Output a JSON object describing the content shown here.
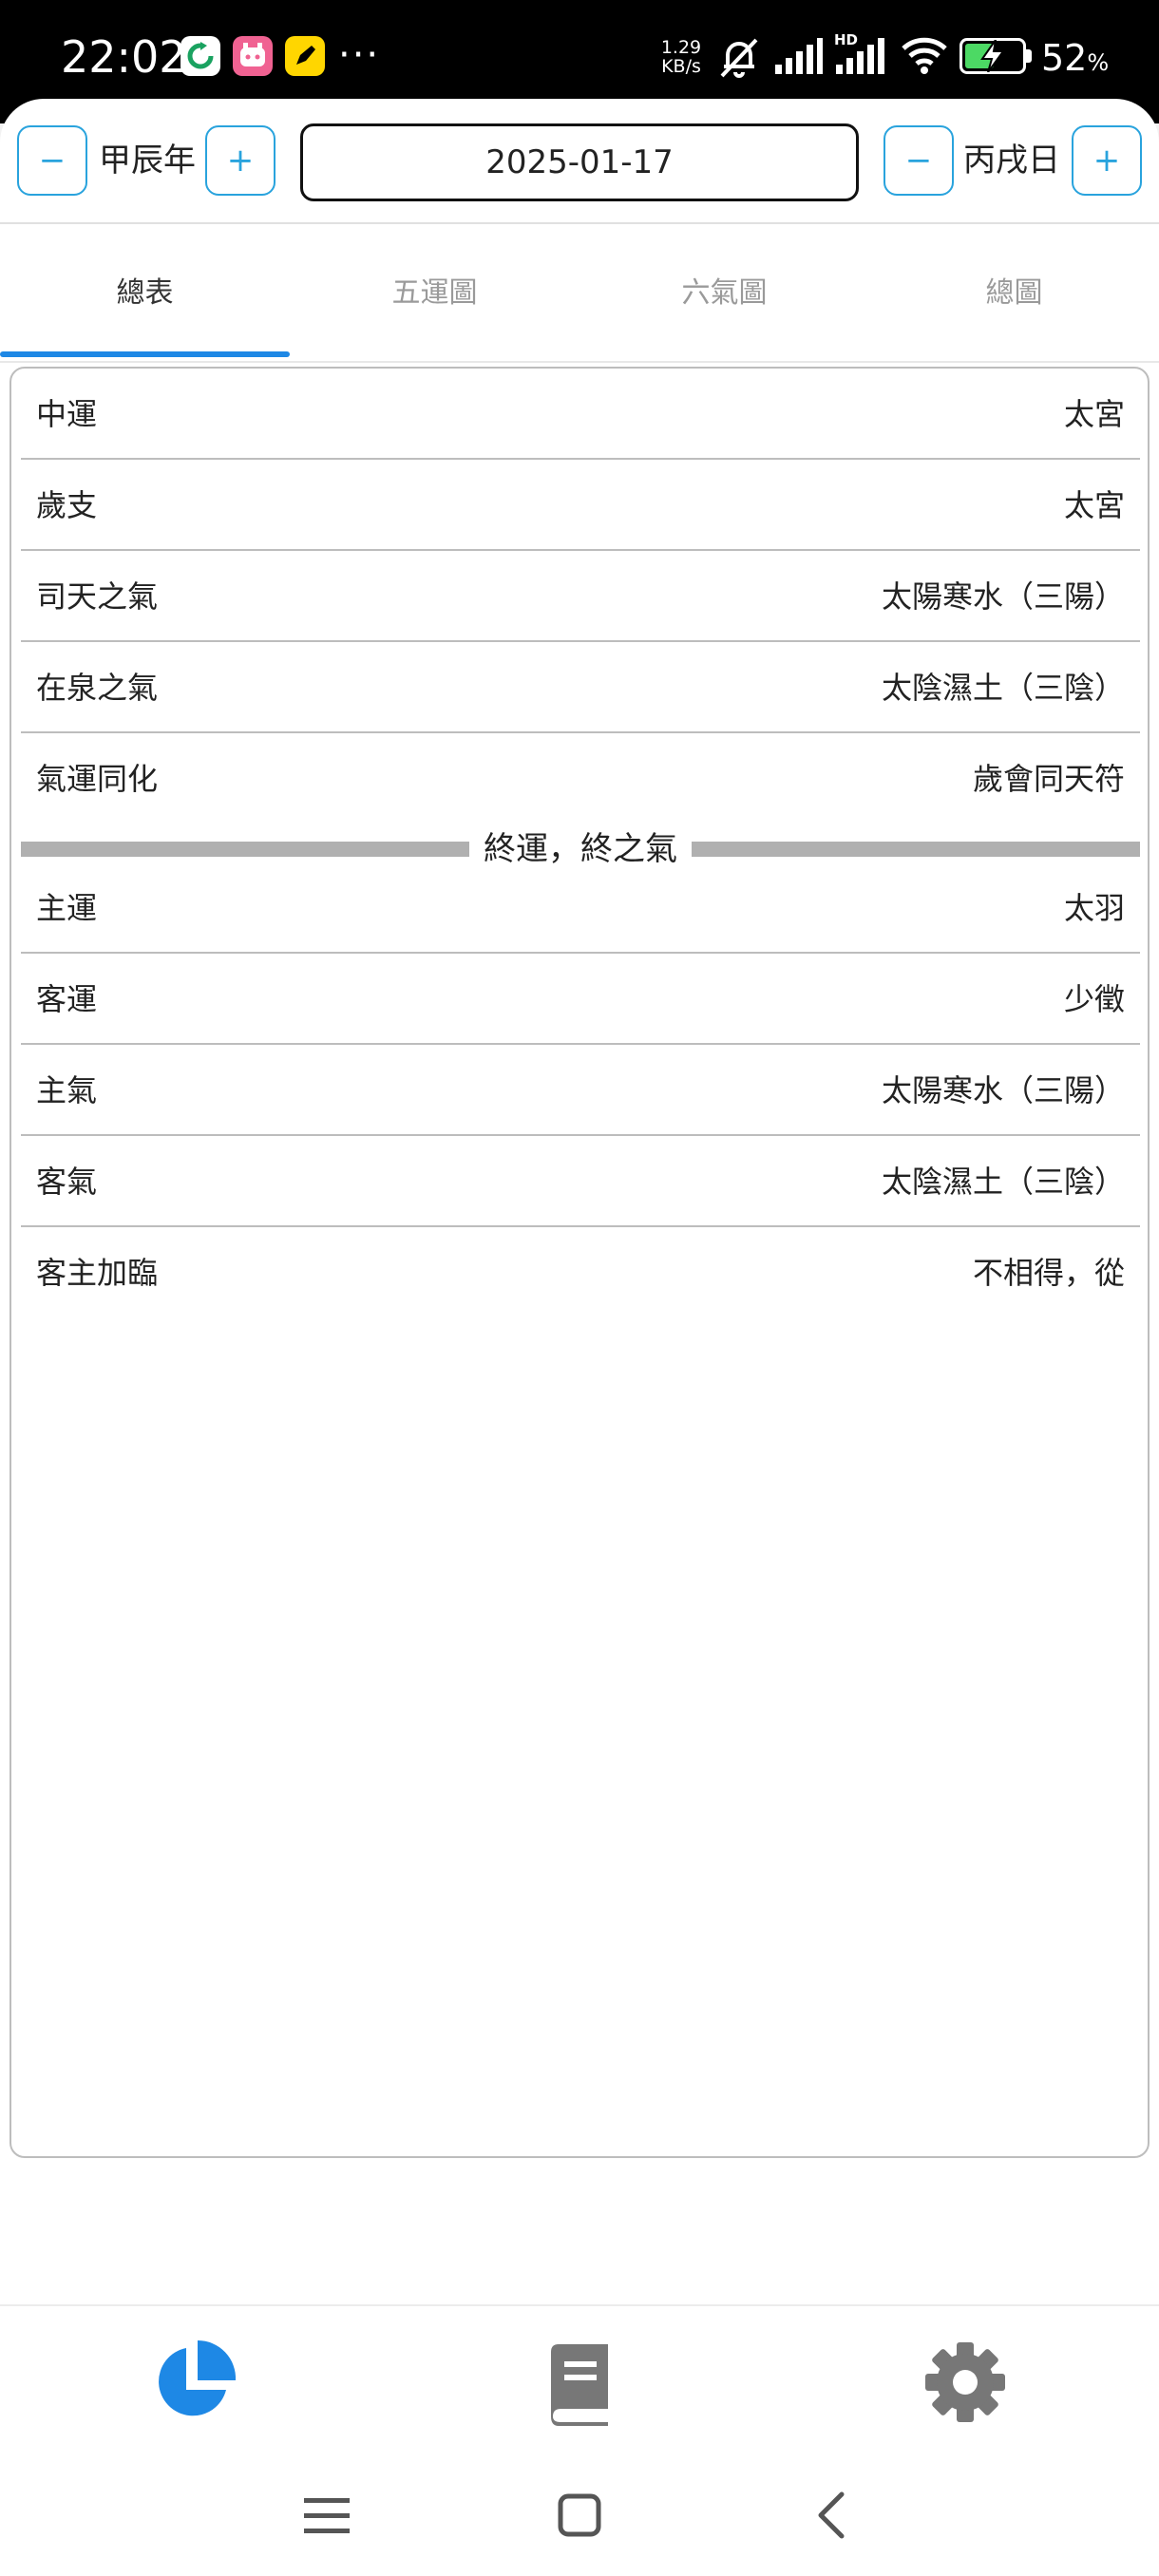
{
  "status_bar": {
    "time": "22:02",
    "app_icons": [
      "refresh-app-icon",
      "alarm-app-icon",
      "pen-app-icon"
    ],
    "more": "···",
    "net_speed_value": "1.29",
    "net_speed_unit": "KB/s",
    "icons": [
      "bell-muted-icon",
      "signal-icon",
      "hd-signal-icon",
      "wifi-icon",
      "battery-charging-icon"
    ],
    "battery_pct": "52",
    "battery_unit": "%",
    "hd_label": "HD",
    "battery_level": 0.52
  },
  "nav": {
    "year_label": "甲辰年",
    "date_value": "2025-01-17",
    "day_label": "丙戌日",
    "minus": "−",
    "plus": "+"
  },
  "tabs": [
    {
      "label": "總表",
      "active": true
    },
    {
      "label": "五運圖",
      "active": false
    },
    {
      "label": "六氣圖",
      "active": false
    },
    {
      "label": "總圖",
      "active": false
    }
  ],
  "table": {
    "year_rows": [
      {
        "key": "中運",
        "value": "太宮"
      },
      {
        "key": "歲支",
        "value": "太宮"
      },
      {
        "key": "司天之氣",
        "value": "太陽寒水（三陽）"
      },
      {
        "key": "在泉之氣",
        "value": "太陰濕土（三陰）"
      },
      {
        "key": "氣運同化",
        "value": "歲會同天符"
      }
    ],
    "section_title": "終運，終之氣",
    "period_rows": [
      {
        "key": "主運",
        "value": "太羽"
      },
      {
        "key": "客運",
        "value": "少徵"
      },
      {
        "key": "主氣",
        "value": "太陽寒水（三陽）"
      },
      {
        "key": "客氣",
        "value": "太陰濕土（三陰）"
      },
      {
        "key": "客主加臨",
        "value": "不相得，從"
      }
    ]
  },
  "bottom_nav": [
    {
      "icon": "pie-chart-icon",
      "active": true
    },
    {
      "icon": "book-icon",
      "active": false
    },
    {
      "icon": "gear-icon",
      "active": false
    }
  ],
  "system_nav": [
    "menu-icon",
    "home-icon",
    "back-icon"
  ],
  "colors": {
    "accent": "#1e88e5",
    "button_border": "#29a3dd",
    "inactive_icon": "#777777",
    "divider": "#bdbdbd"
  }
}
